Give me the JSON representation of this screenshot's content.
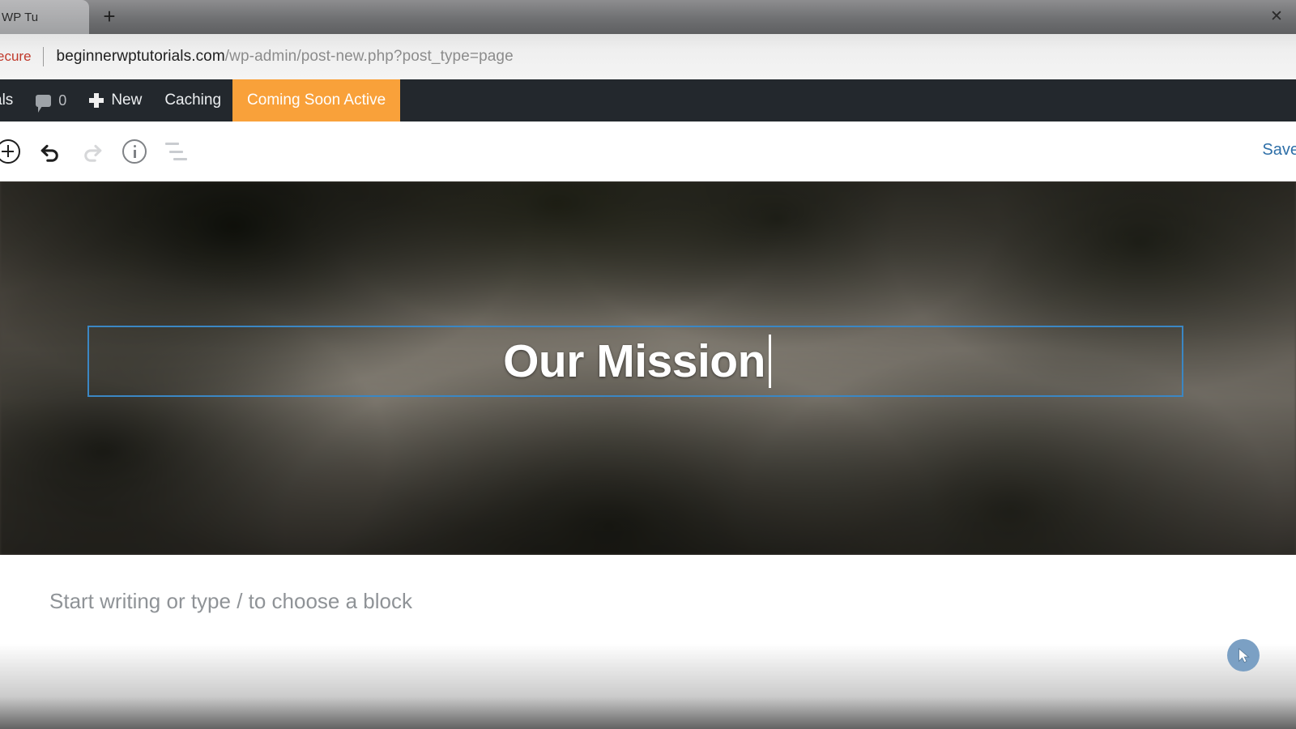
{
  "browser": {
    "tab": {
      "title": "WP Tu",
      "close_icon": "close-icon"
    },
    "new_tab_glyph": "+",
    "security_label": "ecure",
    "url_host": "beginnerwptutorials.com",
    "url_path": "/wp-admin/post-new.php?post_type=page"
  },
  "adminbar": {
    "site_name": "als",
    "comments_icon": "comment-bubble-icon",
    "comments_count": "0",
    "new_icon": "plus-icon",
    "new_label": "New",
    "caching_label": "Caching",
    "badge_label": "Coming Soon Active",
    "badge_color": "#f9a13a",
    "background": "#23282d"
  },
  "toolbar": {
    "add_block_icon": "circle-plus-icon",
    "undo_icon": "undo-arrow-icon",
    "redo_icon": "redo-arrow-icon",
    "details_icon": "info-circle-icon",
    "list_view_icon": "list-view-icon",
    "save_label": "Save",
    "save_color": "#2e6fa8"
  },
  "editor": {
    "cover_block": {
      "name": "cover-block",
      "title_text": "Our Mission",
      "selection_color": "#3b87c4"
    },
    "paragraph_placeholder": "Start writing or type / to choose a block"
  },
  "cursor": {
    "icon": "mouse-pointer-icon",
    "color": "#7ba0c4"
  }
}
